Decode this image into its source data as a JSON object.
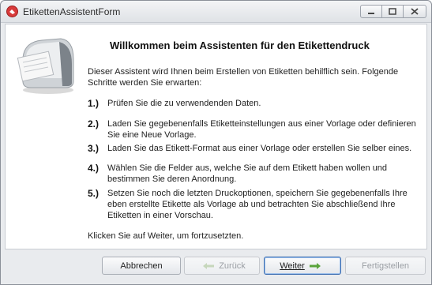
{
  "window": {
    "title": "EtikettenAssistentForm"
  },
  "content": {
    "heading": "Willkommen beim Assistenten für den Etikettendruck",
    "intro": "Dieser Assistent wird Ihnen beim Erstellen von Etiketten behilflich sein. Folgende Schritte werden Sie erwarten:",
    "steps": [
      {
        "num": "1.)",
        "text": "Prüfen Sie die zu verwendenden Daten."
      },
      {
        "num": "2.)",
        "text": "Laden Sie gegebenenfalls Etiketteinstellungen aus einer Vorlage oder definieren Sie eine Neue Vorlage."
      },
      {
        "num": "3.)",
        "text": "Laden Sie das Etikett-Format aus einer Vorlage oder erstellen Sie selber eines."
      },
      {
        "num": "4.)",
        "text": "Wählen Sie die Felder aus, welche Sie auf dem Etikett haben wollen und bestimmen Sie deren Anordnung."
      },
      {
        "num": "5.)",
        "text": "Setzen Sie noch die letzten Druckoptionen, speichern Sie gegebenenfalls Ihre eben erstellte Etikette als Vorlage ab und betrachten Sie abschließend Ihre Etiketten in einer Vorschau."
      }
    ],
    "footer": "Klicken Sie auf Weiter, um fortzusetzten."
  },
  "buttons": {
    "cancel": "Abbrechen",
    "back": "Zurück",
    "next": "Weiter",
    "finish": "Fertigstellen"
  },
  "colors": {
    "accent": "#3d6db0",
    "arrow_green": "#5aa43c"
  }
}
